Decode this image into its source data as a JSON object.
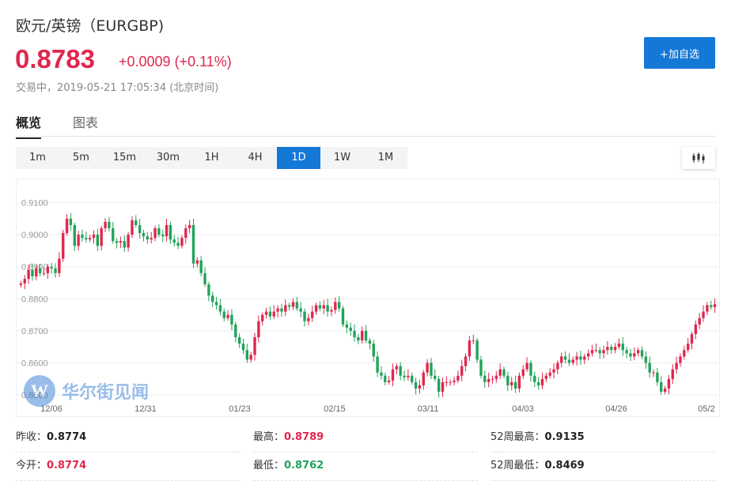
{
  "header": {
    "title": "欧元/英镑（EURGBP)",
    "price": "0.8783",
    "change": "+0.0009 (+0.11%)",
    "status": "交易中，",
    "timestamp": "2019-05-21 17:05:34 (北京时间)",
    "add_button": "+加自选"
  },
  "tabs": [
    {
      "label": "概览",
      "active": true
    },
    {
      "label": "图表",
      "active": false
    }
  ],
  "periods": [
    "1m",
    "5m",
    "15m",
    "30m",
    "1H",
    "4H",
    "1D",
    "1W",
    "1M"
  ],
  "active_period": "1D",
  "chart_type_icon": "candlestick-icon",
  "watermark": {
    "logo": "W",
    "text": "华尔街见闻"
  },
  "colors": {
    "up": "#e0274f",
    "down": "#21a35a",
    "accent": "#1478d6",
    "grid": "#eeeeee"
  },
  "chart_data": {
    "type": "candlestick",
    "y_ticks": [
      "0.9100",
      "0.9000",
      "0.8900",
      "0.8800",
      "0.8700",
      "0.8600",
      "0.8500"
    ],
    "ylim": [
      0.8478,
      0.9158
    ],
    "x_ticks": [
      "12/06",
      "12/31",
      "01/23",
      "02/15",
      "03/11",
      "04/03",
      "04/26",
      "05/2"
    ],
    "closes": [
      0.8848,
      0.8862,
      0.889,
      0.887,
      0.8895,
      0.888,
      0.888,
      0.89,
      0.8895,
      0.888,
      0.8925,
      0.9005,
      0.905,
      0.903,
      0.8965,
      0.9,
      0.899,
      0.8985,
      0.899,
      0.9,
      0.8965,
      0.902,
      0.904,
      0.902,
      0.898,
      0.8975,
      0.898,
      0.896,
      0.9,
      0.9045,
      0.903,
      0.9005,
      0.8995,
      0.8985,
      0.899,
      0.902,
      0.9,
      0.8995,
      0.903,
      0.8985,
      0.8975,
      0.8965,
      0.899,
      0.902,
      0.903,
      0.891,
      0.892,
      0.888,
      0.8845,
      0.881,
      0.879,
      0.878,
      0.876,
      0.874,
      0.875,
      0.872,
      0.868,
      0.866,
      0.864,
      0.861,
      0.8625,
      0.868,
      0.873,
      0.875,
      0.876,
      0.8745,
      0.876,
      0.877,
      0.876,
      0.878,
      0.8775,
      0.879,
      0.877,
      0.876,
      0.873,
      0.874,
      0.876,
      0.878,
      0.877,
      0.878,
      0.876,
      0.8765,
      0.879,
      0.877,
      0.872,
      0.871,
      0.87,
      0.868,
      0.867,
      0.87,
      0.867,
      0.866,
      0.862,
      0.857,
      0.856,
      0.854,
      0.8545,
      0.858,
      0.859,
      0.856,
      0.8555,
      0.856,
      0.854,
      0.852,
      0.853,
      0.857,
      0.86,
      0.856,
      0.855,
      0.851,
      0.854,
      0.854,
      0.854,
      0.8545,
      0.856,
      0.859,
      0.862,
      0.867,
      0.867,
      0.861,
      0.856,
      0.854,
      0.855,
      0.855,
      0.856,
      0.858,
      0.856,
      0.853,
      0.854,
      0.852,
      0.856,
      0.858,
      0.86,
      0.856,
      0.854,
      0.853,
      0.855,
      0.856,
      0.857,
      0.858,
      0.86,
      0.862,
      0.861,
      0.86,
      0.861,
      0.862,
      0.861,
      0.862,
      0.863,
      0.864,
      0.864,
      0.863,
      0.864,
      0.865,
      0.864,
      0.865,
      0.866,
      0.864,
      0.863,
      0.862,
      0.863,
      0.864,
      0.862,
      0.86,
      0.857,
      0.857,
      0.854,
      0.851,
      0.852,
      0.855,
      0.858,
      0.86,
      0.862,
      0.864,
      0.866,
      0.869,
      0.872,
      0.874,
      0.876,
      0.878,
      0.8774,
      0.8783
    ]
  },
  "stats": [
    {
      "label": "昨收：",
      "value": "0.8774",
      "color": "black"
    },
    {
      "label": "最高：",
      "value": "0.8789",
      "color": "red"
    },
    {
      "label": "52周最高：",
      "value": "0.9135",
      "color": "black"
    },
    {
      "label": "今开：",
      "value": "0.8774",
      "color": "red"
    },
    {
      "label": "最低：",
      "value": "0.8762",
      "color": "green"
    },
    {
      "label": "52周最低：",
      "value": "0.8469",
      "color": "black"
    }
  ]
}
